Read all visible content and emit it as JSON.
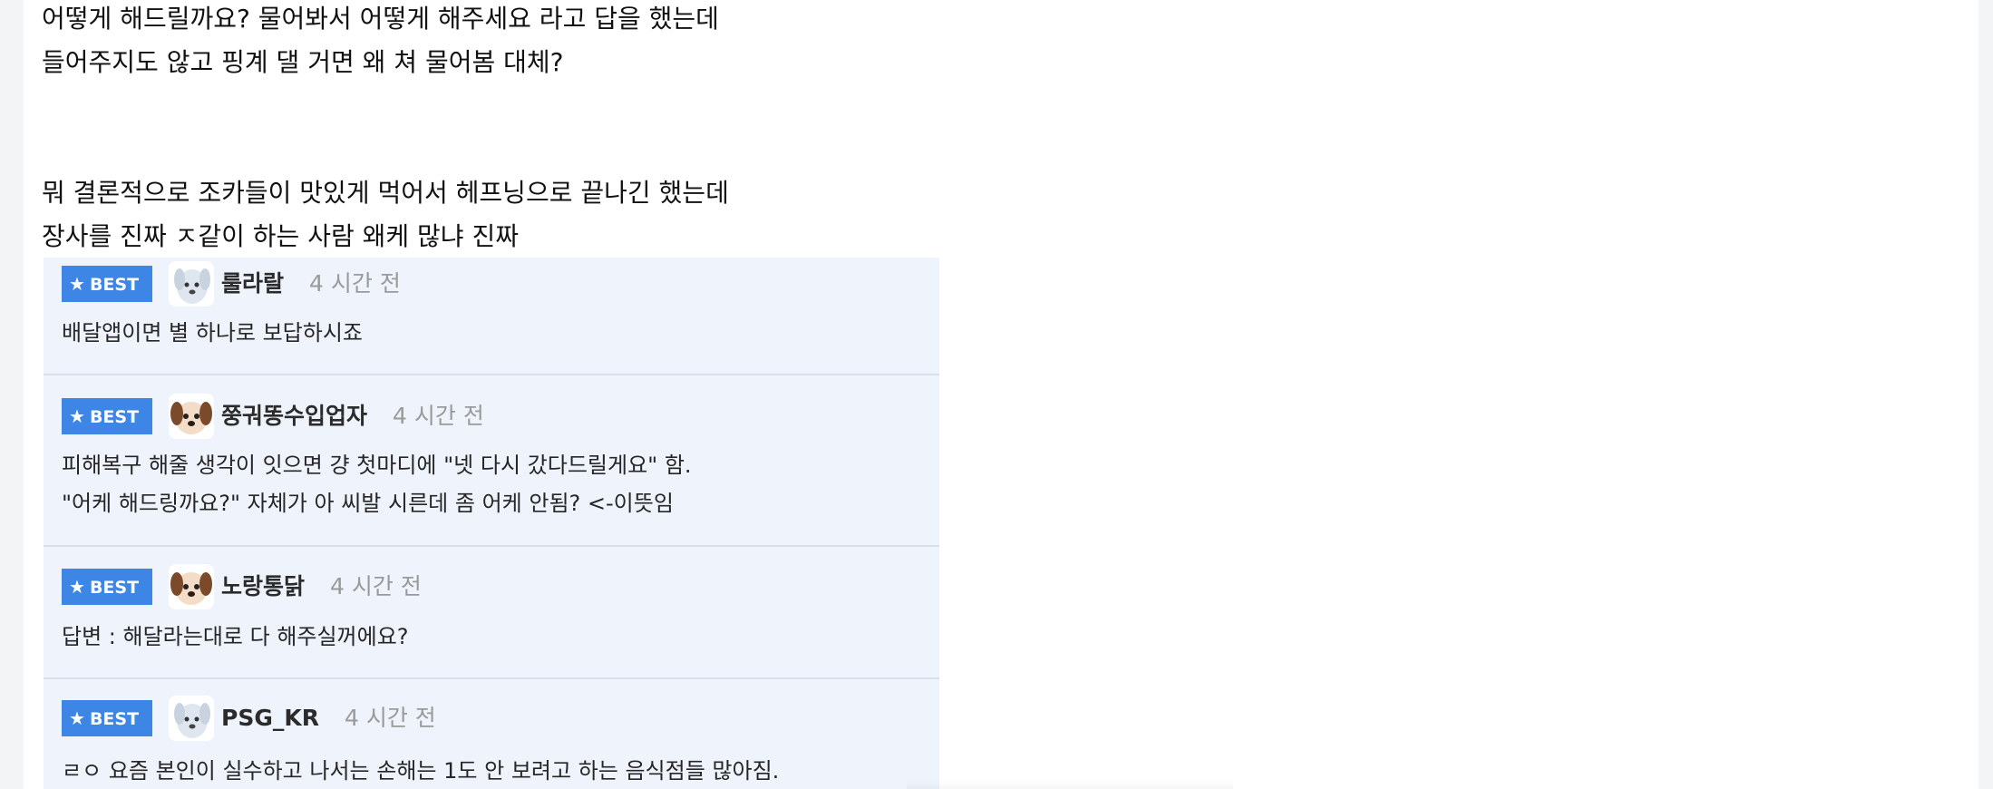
{
  "post": {
    "lines": [
      "어떻게 해드릴까요? 물어봐서 어떻게 해주세요 라고 답을 했는데",
      "들어주지도 않고 핑계 댈 거면 왜 쳐 물어봄 대체?",
      "뭐 결론적으로 조카들이 맛있게 먹어서 헤프닝으로 끝나긴 했는데",
      "장사를 진짜 ㅈ같이 하는 사람 왜케 많냐 진짜"
    ]
  },
  "comments": [
    {
      "badge": "BEST",
      "badge_icon": "star-icon",
      "avatar_icon": "white-puppy-avatar",
      "nickname": "룰라랄",
      "time": "4 시간 전",
      "lines": [
        "배달앱이면 별 하나로 보답하시죠"
      ]
    },
    {
      "badge": "BEST",
      "badge_icon": "star-icon",
      "avatar_icon": "brown-puppy-avatar",
      "nickname": "쭝궈똥수입업자",
      "time": "4 시간 전",
      "lines": [
        "피해복구 해줄 생각이 잇으면 걍 첫마디에 \"넷 다시 갔다드릴게요\" 함.",
        "\"어케 해드링까요?\" 자체가 아 씨발 시른데 좀 어케 안됨? <-이뜻임"
      ]
    },
    {
      "badge": "BEST",
      "badge_icon": "star-icon",
      "avatar_icon": "brown-puppy-avatar",
      "nickname": "노랑통닭",
      "time": "4 시간 전",
      "lines": [
        "답변 : 해달라는대로 다 해주실꺼에요?"
      ]
    },
    {
      "badge": "BEST",
      "badge_icon": "star-icon",
      "avatar_icon": "white-puppy-avatar",
      "nickname": "PSG_KR",
      "time": "4 시간 전",
      "lines": [
        "ㄹㅇ 요즘 본인이 실수하고 나서는 손해는 1도 안 보려고 하는 음식점들 많아짐."
      ]
    }
  ],
  "colors": {
    "badge_bg": "#3d86e6",
    "comment_bg": "#eef3fc",
    "time_text": "#9a9a9a"
  }
}
